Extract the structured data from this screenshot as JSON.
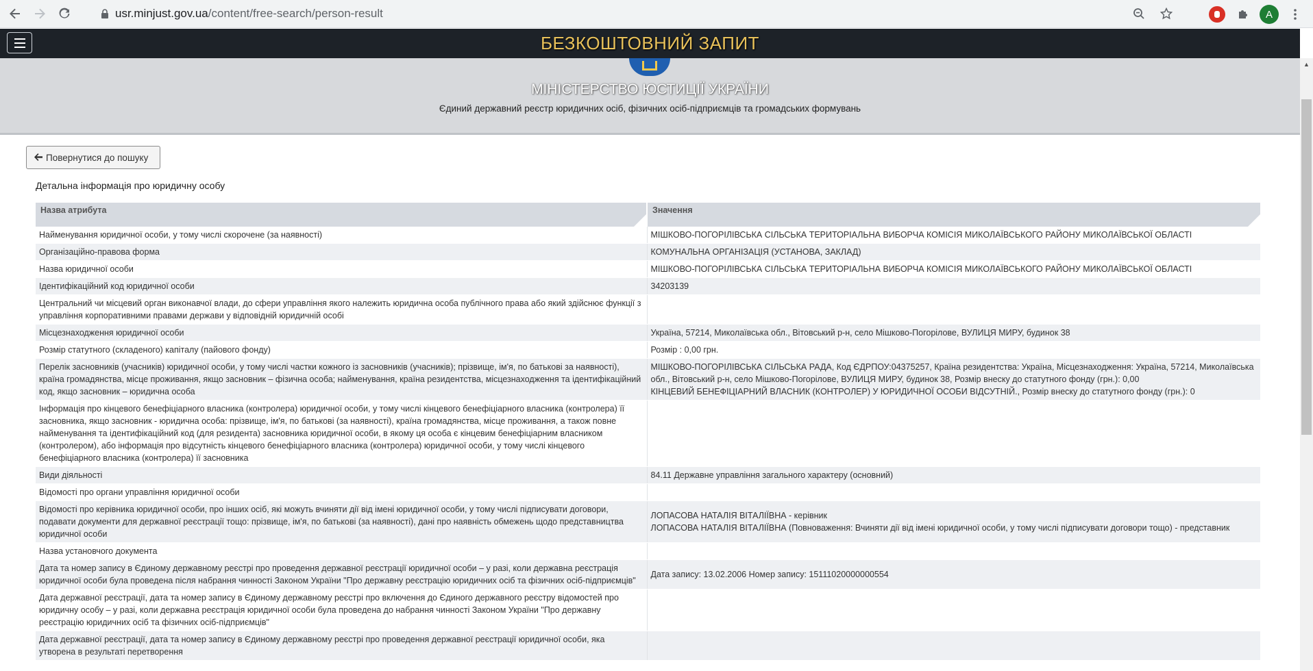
{
  "browser": {
    "url_host": "usr.minjust.gov.ua",
    "url_path": "/content/free-search/person-result",
    "profile_initial": "A"
  },
  "site": {
    "top_title": "БЕЗКОШТОВНИЙ ЗАПИТ",
    "ministry": "МІНІСТЕРСТВО ЮСТИЦІЇ УКРАЇНИ",
    "registry": "Єдиний державний реєстр юридичних осіб, фізичних осіб-підприємців та громадських формувань"
  },
  "content": {
    "back_label": "Повернутися до пошуку",
    "section_title": "Детальна інформація про юридичну особу",
    "headers": [
      "Назва атрибута",
      "Значення"
    ],
    "rows": [
      {
        "attr": "Найменування юридичної особи, у тому числі скорочене (за наявності)",
        "value": [
          "МІШКОВО-ПОГОРІЛІВСЬКА СІЛЬСЬКА ТЕРИТОРІАЛЬНА ВИБОРЧА КОМІСІЯ МИКОЛАЇВСЬКОГО РАЙОНУ МИКОЛАЇВСЬКОЇ ОБЛАСТІ"
        ]
      },
      {
        "attr": "Організаційно-правова форма",
        "value": [
          "КОМУНАЛЬНА ОРГАНІЗАЦІЯ (УСТАНОВА, ЗАКЛАД)"
        ]
      },
      {
        "attr": "Назва юридичної особи",
        "value": [
          "МІШКОВО-ПОГОРІЛІВСЬКА СІЛЬСЬКА ТЕРИТОРІАЛЬНА ВИБОРЧА КОМІСІЯ МИКОЛАЇВСЬКОГО РАЙОНУ МИКОЛАЇВСЬКОЇ ОБЛАСТІ"
        ]
      },
      {
        "attr": "Ідентифікаційний код юридичної особи",
        "value": [
          "34203139"
        ]
      },
      {
        "attr": "Центральний чи місцевий орган виконавчої влади, до сфери управління якого належить юридична особа публічного права або який здійснює функції з управління корпоративними правами держави у відповідній юридичній особі",
        "value": []
      },
      {
        "attr": "Місцезнаходження юридичної особи",
        "value": [
          "Україна, 57214, Миколаївська обл., Вітовський р-н, село Мішково-Погорілове, ВУЛИЦЯ МИРУ, будинок 38"
        ]
      },
      {
        "attr": "Розмір статутного (складеного) капіталу (пайового фонду)",
        "value": [
          "Розмір : 0,00 грн."
        ]
      },
      {
        "attr": "Перелік засновників (учасників) юридичної особи, у тому числі частки кожного із засновників (учасників); прізвище, ім'я, по батькові за наявності), країна громадянства, місце проживання, якщо засновник – фізична особа; найменування, країна резидентства, місцезнаходження та ідентифікаційний код, якщо засновник – юридична особа",
        "value": [
          "МІШКОВО-ПОГОРІЛІВСЬКА СІЛЬСЬКА РАДА, Код ЄДРПОУ:04375257, Країна резидентства: Україна, Місцезнаходження: Україна, 57214, Миколаївська обл., Вітовський р-н, село Мішково-Погорілове, ВУЛИЦЯ МИРУ, будинок 38, Розмір внеску до статутного фонду (грн.): 0,00",
          "КІНЦЕВИЙ БЕНЕФІЦІАРНИЙ ВЛАСНИК (КОНТРОЛЕР) У ЮРИДИЧНОЇ ОСОБИ ВІДСУТНІЙ., Розмір внеску до статутного фонду (грн.): 0"
        ]
      },
      {
        "attr": "Інформація про кінцевого бенефіціарного власника (контролера) юридичної особи, у тому числі кінцевого бенефіціарного власника (контролера) її засновника, якщо засновник - юридична особа: прізвище, ім'я, по батькові (за наявності), країна громадянства, місце проживання, а також повне найменування та ідентифікаційний код (для резидента) засновника юридичної особи, в якому ця особа є кінцевим бенефіціарним власником (контролером), або інформація про відсутність кінцевого бенефіціарного власника (контролера) юридичної особи, у тому числі кінцевого бенефіціарного власника (контролера) її засновника",
        "value": []
      },
      {
        "attr": "Види діяльності",
        "value": [
          "84.11 Державне управління загального характеру (основний)"
        ]
      },
      {
        "attr": "Відомості про органи управління юридичної особи",
        "value": []
      },
      {
        "attr": "Відомості про керівника юридичної особи, про інших осіб, які можуть вчиняти дії від імені юридичної особи, у тому числі підписувати договори, подавати документи для державної реєстрації тощо: прізвище, ім'я, по батькові (за наявності), дані про наявність обмежень щодо представництва юридичної особи",
        "value": [
          "ЛОПАСОВА НАТАЛІЯ ВІТАЛІЇВНА - керівник",
          "ЛОПАСОВА НАТАЛІЯ ВІТАЛІЇВНА (Повноваження: Вчиняти дії від імені юридичної особи, у тому числі підписувати договори тощо) - представник"
        ]
      },
      {
        "attr": "Назва установчого документа",
        "value": []
      },
      {
        "attr": "Дата та номер запису в Єдиному державному реєстрі про проведення державної реєстрації юридичної особи – у разі, коли державна реєстрація юридичної особи була проведена після набрання чинності Законом України \"Про державну реєстрацію юридичних осіб та фізичних осіб-підприємців\"",
        "value": [
          "Дата запису: 13.02.2006 Номер запису: 15111020000000554"
        ]
      },
      {
        "attr": "Дата державної реєстрації, дата та номер запису в Єдиному державному реєстрі про включення до Єдиного державного реєстру відомостей про юридичну особу – у разі, коли державна реєстрація юридичної особи була проведена до набрання чинності Законом України \"Про державну реєстрацію юридичних осіб та фізичних осіб-підприємців\"",
        "value": []
      },
      {
        "attr": "Дата державної реєстрації, дата та номер запису в Єдиному державному реєстрі про проведення державної реєстрації юридичної особи, яка утворена в результаті перетворення",
        "value": []
      }
    ]
  }
}
